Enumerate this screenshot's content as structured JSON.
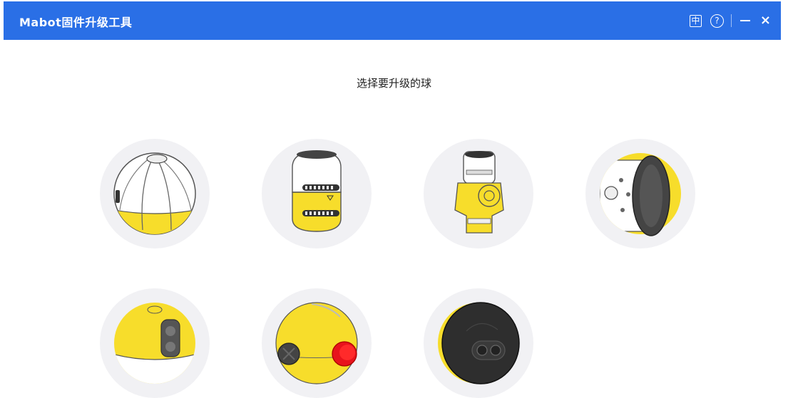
{
  "window": {
    "title": "Mabot固件升级工具",
    "controls": {
      "language_label": "中",
      "help_label": "?",
      "close_label": "×"
    },
    "colors": {
      "titlebar": "#2a6fe6",
      "ball_bg": "#f1f1f4",
      "yellow": "#f7dd2b",
      "dark": "#3a3a3a",
      "red": "#e8131c"
    }
  },
  "main": {
    "heading": "选择要升级的球",
    "balls": [
      {
        "name": "main-controller-ball",
        "icon": "controller-ball-icon"
      },
      {
        "name": "battery-ball",
        "icon": "battery-ball-icon"
      },
      {
        "name": "servo-ball",
        "icon": "servo-ball-icon"
      },
      {
        "name": "drive-wheel-ball",
        "icon": "wheel-ball-icon"
      },
      {
        "name": "color-sensor-ball",
        "icon": "color-sensor-icon"
      },
      {
        "name": "touch-sensor-ball",
        "icon": "touch-sensor-icon"
      },
      {
        "name": "infrared-sensor-ball",
        "icon": "infrared-sensor-icon"
      }
    ]
  }
}
